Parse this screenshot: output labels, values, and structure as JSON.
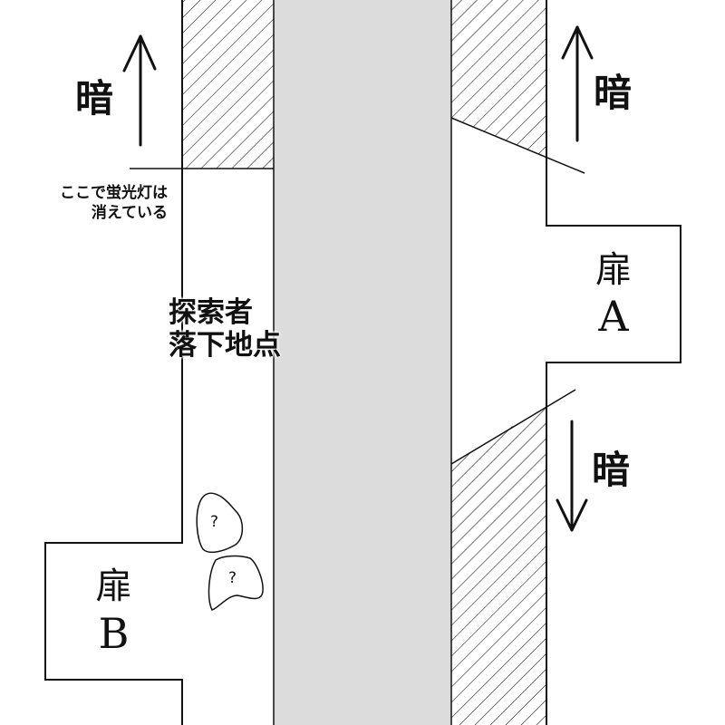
{
  "labels": {
    "dark_left_top": "暗",
    "dark_right_top": "暗",
    "dark_right_bottom": "暗"
  },
  "notes": {
    "light_off_line1": "ここで蛍光灯は",
    "light_off_line2": "消えている"
  },
  "fall_point": {
    "line1": "探索者",
    "line2": "落下地点"
  },
  "doors": {
    "a": {
      "kanji": "扉",
      "letter": "A"
    },
    "b": {
      "kanji": "扉",
      "letter": "B"
    }
  },
  "unknown_objects": [
    {
      "mark": "?"
    },
    {
      "mark": "?"
    }
  ],
  "colors": {
    "road": "#dcdcdc",
    "line": "#111111",
    "background": "#ffffff"
  },
  "icons": {
    "arrow_up": "arrow-up-icon",
    "arrow_down": "arrow-down-icon",
    "hatch": "hatched-dark-area"
  }
}
